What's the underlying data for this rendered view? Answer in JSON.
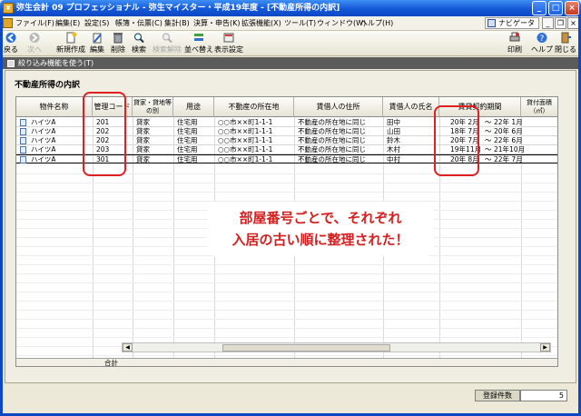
{
  "window": {
    "title": "弥生会計 09 プロフェッショナル - 弥生マイスター・平成19年度 - [不動産所得の内訳]"
  },
  "menu": {
    "items": [
      "ファイル(F)",
      "編集(E)",
      "設定(S)",
      "帳簿・伝票(C)",
      "集計(B)",
      "決算・申告(K)",
      "拡張機能(X)",
      "ツール(T)",
      "ウィンドウ(W)",
      "ヘルプ(H)"
    ],
    "navi_label": "ナビゲータ"
  },
  "toolbar": {
    "back": "戻る",
    "next": "次へ",
    "new": "新規作成",
    "edit": "編集",
    "delete": "削除",
    "search": "検索",
    "search_cancel": "検索解除",
    "sort": "並べ替え",
    "display_settings": "表示設定",
    "print": "印刷",
    "help": "ヘルプ",
    "close": "閉じる"
  },
  "filter": {
    "label": "絞り込み機能を使う(T)"
  },
  "section": {
    "title": "不動産所得の内訳"
  },
  "table": {
    "headers": {
      "name": "物件名称",
      "code": "管理コード",
      "type": "貸家・貸地等の別",
      "usage": "用途",
      "location": "不動産の所在地",
      "tenant_address": "賃借人の住所",
      "tenant_name": "賃借人の氏名",
      "period": "賃貸契約期間",
      "area": "貸付面積（㎡）"
    },
    "rows": [
      {
        "name": "ハイツA",
        "code": "201",
        "type": "貸家",
        "usage": "住宅用",
        "location": "○○市××町1-1-1",
        "tenant_address": "不動産の所在地に同じ",
        "tenant_name": "田中",
        "from": "20年 2月",
        "sep": "～",
        "to": "22年 1月"
      },
      {
        "name": "ハイツA",
        "code": "202",
        "type": "貸家",
        "usage": "住宅用",
        "location": "○○市××町1-1-1",
        "tenant_address": "不動産の所在地に同じ",
        "tenant_name": "山田",
        "from": "18年 7月",
        "sep": "～",
        "to": "20年 6月"
      },
      {
        "name": "ハイツA",
        "code": "202",
        "type": "貸家",
        "usage": "住宅用",
        "location": "○○市××町1-1-1",
        "tenant_address": "不動産の所在地に同じ",
        "tenant_name": "鈴木",
        "from": "20年 7月",
        "sep": "～",
        "to": "22年 6月"
      },
      {
        "name": "ハイツA",
        "code": "203",
        "type": "貸家",
        "usage": "住宅用",
        "location": "○○市××町1-1-1",
        "tenant_address": "不動産の所在地に同じ",
        "tenant_name": "木村",
        "from": "19年11月",
        "sep": "～",
        "to": "21年10月"
      },
      {
        "name": "ハイツA",
        "code": "301",
        "type": "貸家",
        "usage": "住宅用",
        "location": "○○市××町1-1-1",
        "tenant_address": "不動産の所在地に同じ",
        "tenant_name": "中村",
        "from": "20年 8月",
        "sep": "～",
        "to": "22年 7月"
      }
    ],
    "total_label": "合計"
  },
  "callout": {
    "line1": "部屋番号ごとで、それぞれ",
    "line2": "入居の古い順に整理された！"
  },
  "status": {
    "count_label": "登録件数",
    "count_value": "5"
  },
  "colors": {
    "title_bar": "#1458d6",
    "annotation": "#e02020"
  }
}
